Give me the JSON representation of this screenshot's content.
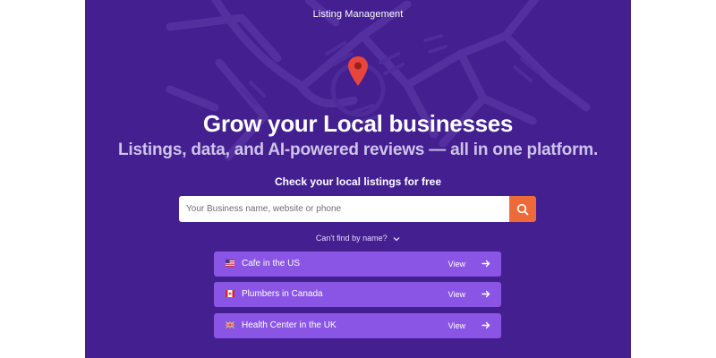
{
  "header": {
    "eyebrow": "Listing Management"
  },
  "hero": {
    "title": "Grow your Local businesses",
    "subtitle": "Listings, data, and AI-powered reviews — all in one platform."
  },
  "search": {
    "heading": "Check your local listings for free",
    "placeholder": "Your Business name, website or phone",
    "button_icon": "search-icon"
  },
  "cant_find": {
    "label": "Can't find by name?"
  },
  "listings": [
    {
      "flag": "us-flag-icon",
      "label": "Cafe in the US",
      "action": "View"
    },
    {
      "flag": "canada-flag-icon",
      "label": "Plumbers in Canada",
      "action": "View"
    },
    {
      "flag": "uk-flag-icon",
      "label": "Health Center in the UK",
      "action": "View"
    }
  ],
  "colors": {
    "hero_background": "#431f8f",
    "search_button": "#ef6a3a",
    "listing_background": "#8a55e4",
    "subtitle_text": "#cfc3ea",
    "pin": "#e8453c"
  }
}
